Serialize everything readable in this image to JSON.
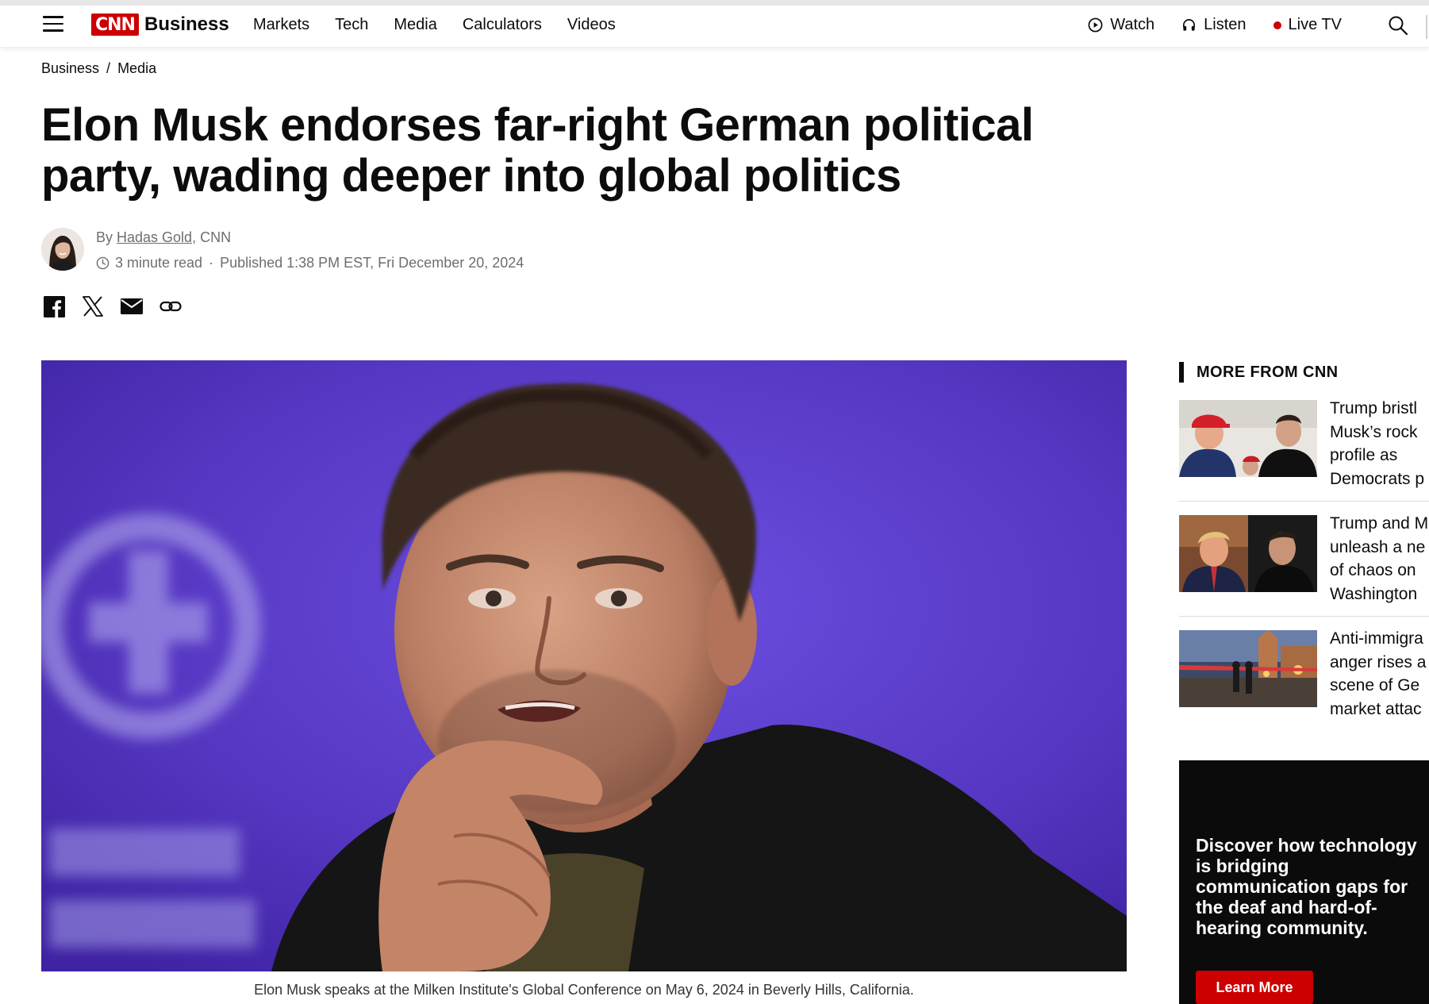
{
  "nav": {
    "logo_text": "CNN",
    "section": "Business",
    "links": [
      "Markets",
      "Tech",
      "Media",
      "Calculators",
      "Videos"
    ],
    "watch": "Watch",
    "listen": "Listen",
    "live_tv": "Live TV"
  },
  "breadcrumb": [
    "Business",
    "Media"
  ],
  "article": {
    "headline": "Elon Musk endorses far-right German political party, wading deeper into global politics",
    "byline_prefix": "By ",
    "author": "Hadas Gold",
    "outlet": ", CNN",
    "read_time": "3 minute read",
    "published": "Published 1:38 PM EST, Fri December 20, 2024",
    "caption": "Elon Musk speaks at the Milken Institute's Global Conference on May 6, 2024 in Beverly Hills, California."
  },
  "sidebar": {
    "header": "MORE FROM CNN",
    "stories": [
      {
        "title_lines": [
          "Trump bristl",
          "Musk’s rock",
          "profile as",
          "Democrats p"
        ]
      },
      {
        "title_lines": [
          "Trump and M",
          "unleash a ne",
          "of chaos on",
          "Washington"
        ]
      },
      {
        "title_lines": [
          "Anti-immigra",
          "anger rises a",
          "scene of Ge",
          "market attac"
        ]
      }
    ]
  },
  "ad": {
    "text": "Discover how technology is bridging communication gaps for the deaf and hard-of-hearing community.",
    "button": "Learn More"
  },
  "colors": {
    "brand_red": "#cc0000",
    "hero_background": "#5a3fc8"
  }
}
